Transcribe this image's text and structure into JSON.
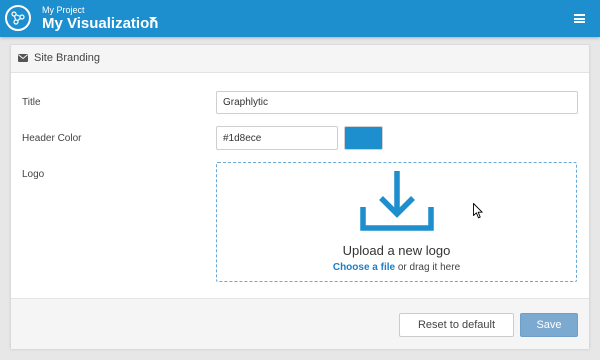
{
  "header": {
    "project_label": "My Project",
    "visualization_title": "My Visualization",
    "brand_color": "#1d8ece",
    "logo_icon": "graph-nodes-icon",
    "menu_icon": "hamburger-menu-icon"
  },
  "panel": {
    "title": "Site Branding",
    "title_icon": "envelope-icon"
  },
  "form": {
    "title_label": "Title",
    "title_value": "Graphlytic",
    "header_color_label": "Header Color",
    "header_color_value": "#1d8ece",
    "logo_label": "Logo",
    "upload_title": "Upload a new logo",
    "choose_file_link": "Choose a file",
    "drag_text": " or drag it here",
    "upload_icon": "download-icon"
  },
  "footer": {
    "reset_label": "Reset to default",
    "save_label": "Save"
  }
}
